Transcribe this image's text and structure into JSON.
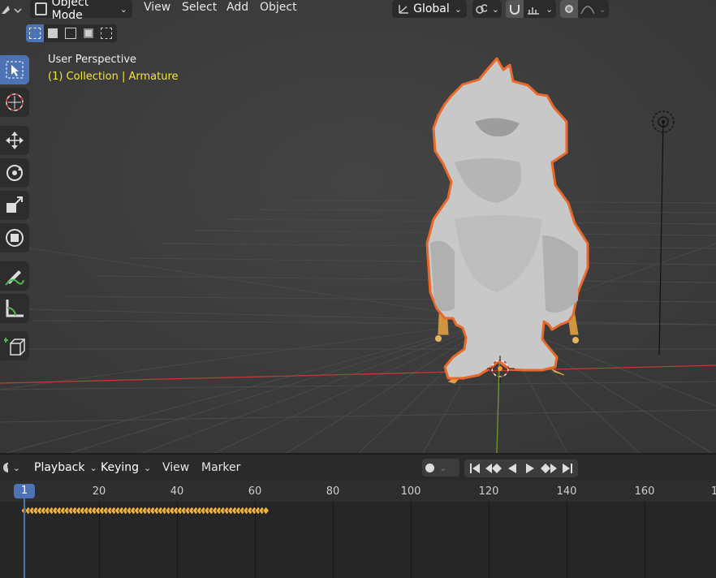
{
  "header": {
    "mode_label": "Object Mode",
    "menus": [
      "View",
      "Select",
      "Add",
      "Object"
    ],
    "orientation_label": "Global"
  },
  "viewport": {
    "title": "User Perspective",
    "subtitle": "(1) Collection | Armature"
  },
  "toolbar": {
    "tools": [
      "select-box",
      "cursor",
      "move",
      "rotate",
      "scale",
      "transform",
      "annotate",
      "measure",
      "add-cube"
    ]
  },
  "timeline": {
    "menus": [
      "Playback",
      "Keying",
      "View",
      "Marker"
    ],
    "current_frame": "1",
    "ticks": [
      "20",
      "40",
      "60",
      "80",
      "100",
      "120",
      "140",
      "160",
      "1"
    ],
    "keyframe_range": [
      0,
      62
    ]
  },
  "colors": {
    "accent": "#4d73b4",
    "selection_outline": "#e8692a",
    "keyframe": "#f0b43c",
    "overlay_text": "#f3e43d"
  }
}
